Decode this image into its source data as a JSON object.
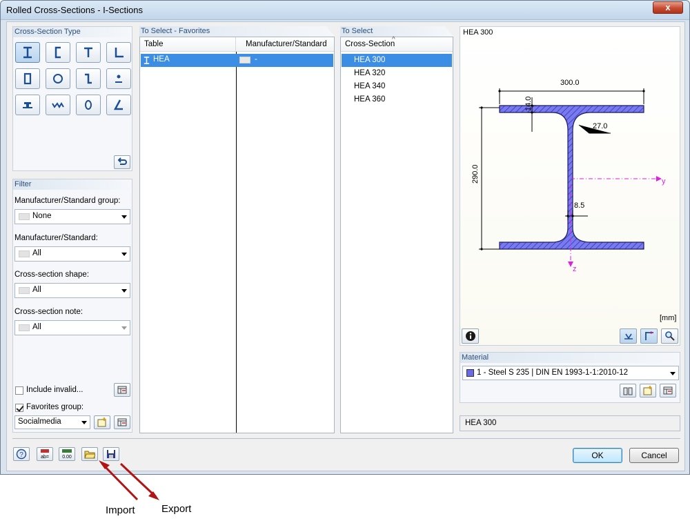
{
  "window": {
    "title": "Rolled Cross-Sections - I-Sections",
    "close_label": "x"
  },
  "type_panel": {
    "title": "Cross-Section Type"
  },
  "filter": {
    "title": "Filter",
    "group_label": "Manufacturer/Standard group:",
    "group_value": "None",
    "standard_label": "Manufacturer/Standard:",
    "standard_value": "All",
    "shape_label": "Cross-section shape:",
    "shape_value": "All",
    "note_label": "Cross-section note:",
    "note_value": "All",
    "include_invalid_label": "Include invalid...",
    "include_invalid_checked": false,
    "favorites_label": "Favorites group:",
    "favorites_checked": true,
    "favorites_value": "Socialmedia"
  },
  "favorites": {
    "title": "To Select - Favorites",
    "col_table": "Table",
    "col_standard": "Manufacturer/Standard",
    "rows": [
      {
        "table": "HEA",
        "standard": "-"
      }
    ]
  },
  "to_select": {
    "title": "To Select",
    "col": "Cross-Section",
    "sort_indicator": "^",
    "items": [
      "HEA 300",
      "HEA 320",
      "HEA 340",
      "HEA 360"
    ],
    "selected_index": 0
  },
  "preview": {
    "title": "HEA 300",
    "dims": {
      "width": "300.0",
      "flange": "14.0",
      "radius": "27.0",
      "height": "290.0",
      "web": "8.5"
    },
    "axis_y": "y",
    "axis_z": "z",
    "unit": "[mm]",
    "section_color": "#7070ff"
  },
  "material": {
    "title": "Material",
    "value": "1 - Steel S 235 | DIN EN 1993-1-1:2010-12",
    "color": "#6a6ae8"
  },
  "selected_display": "HEA 300",
  "buttons": {
    "ok": "OK",
    "cancel": "Cancel"
  },
  "annotations": {
    "import": "Import",
    "export": "Export"
  }
}
